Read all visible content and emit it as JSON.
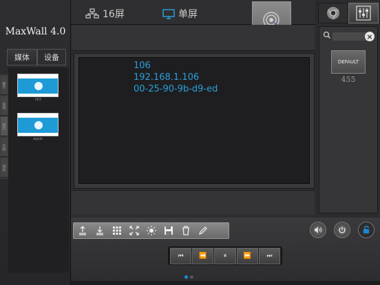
{
  "app": {
    "title": "MaxWall 4.0"
  },
  "left": {
    "tabs": [
      {
        "label": "媒体"
      },
      {
        "label": "设备"
      }
    ],
    "side_items": [
      {
        "label": "图片"
      },
      {
        "label": "视频"
      },
      {
        "label": "网页"
      },
      {
        "label": "文档"
      },
      {
        "label": "相机"
      }
    ],
    "media": [
      {
        "caption": "163",
        "icon": "play-icon"
      },
      {
        "caption": "apple",
        "icon": "play-icon"
      }
    ]
  },
  "topbar": {
    "grid_label": "16屏",
    "single_label": "单屏",
    "cast_icon": "touch-cast-icon"
  },
  "screen": {
    "lines": [
      "106",
      "192.168.1.106",
      "00-25-90-9b-d9-ed"
    ]
  },
  "right": {
    "default_label": "DEFAULT",
    "default_caption": "455",
    "chrome_icon": "chrome-icon",
    "mixer_icon": "mixer-icon"
  },
  "toolbar": {
    "tools": [
      "upload-icon",
      "download-icon",
      "grid-icon",
      "fullscreen-icon",
      "brightness-icon",
      "save-icon",
      "trash-icon",
      "pen-icon"
    ]
  },
  "player": {
    "buttons": [
      {
        "name": "skip-back-button",
        "glyph": "⏮"
      },
      {
        "name": "rewind-button",
        "glyph": "⏪"
      },
      {
        "name": "pause-button",
        "glyph": "⏸"
      },
      {
        "name": "fast-forward-button",
        "glyph": "⏩"
      },
      {
        "name": "skip-forward-button",
        "glyph": "⏭"
      }
    ]
  },
  "colors": {
    "accent": "#2a9fd8",
    "lock": "#1a8ad4"
  }
}
